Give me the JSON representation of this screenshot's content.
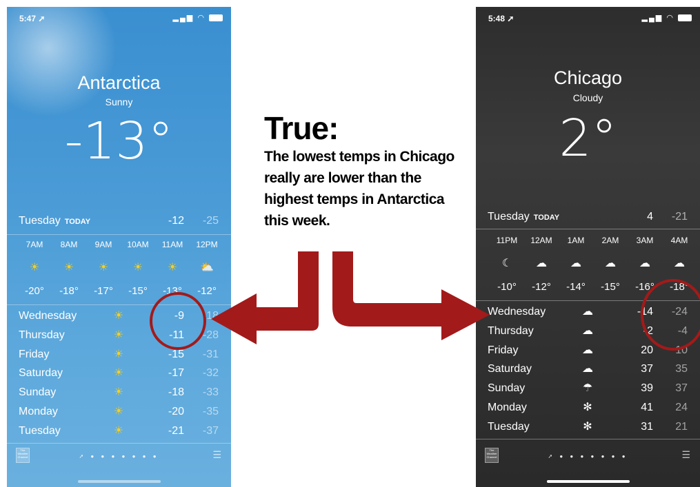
{
  "left_phone": {
    "status_time": "5:47",
    "city": "Antarctica",
    "condition": "Sunny",
    "temp": "-13°",
    "today": {
      "day": "Tuesday",
      "label": "TODAY",
      "hi": "-12",
      "lo": "-25"
    },
    "hourly": [
      {
        "t": "7AM",
        "icon": "sun-icon",
        "v": "-20°"
      },
      {
        "t": "8AM",
        "icon": "sun-icon",
        "v": "-18°"
      },
      {
        "t": "9AM",
        "icon": "sun-icon",
        "v": "-17°"
      },
      {
        "t": "10AM",
        "icon": "sun-icon",
        "v": "-15°"
      },
      {
        "t": "11AM",
        "icon": "sun-icon",
        "v": "-13°"
      },
      {
        "t": "12PM",
        "icon": "partly-sunny-icon",
        "v": "-12°"
      }
    ],
    "daily": [
      {
        "day": "Wednesday",
        "icon": "sun-icon",
        "hi": "-9",
        "lo": "-18"
      },
      {
        "day": "Thursday",
        "icon": "sun-icon",
        "hi": "-11",
        "lo": "-28"
      },
      {
        "day": "Friday",
        "icon": "sun-icon",
        "hi": "-15",
        "lo": "-31"
      },
      {
        "day": "Saturday",
        "icon": "sun-icon",
        "hi": "-17",
        "lo": "-32"
      },
      {
        "day": "Sunday",
        "icon": "sun-icon",
        "hi": "-18",
        "lo": "-33"
      },
      {
        "day": "Monday",
        "icon": "sun-icon",
        "hi": "-20",
        "lo": "-35"
      },
      {
        "day": "Tuesday",
        "icon": "sun-icon",
        "hi": "-21",
        "lo": "-37"
      }
    ],
    "footer_logo": "The Weather Channel"
  },
  "right_phone": {
    "status_time": "5:48",
    "city": "Chicago",
    "condition": "Cloudy",
    "temp": "2°",
    "today": {
      "day": "Tuesday",
      "label": "TODAY",
      "hi": "4",
      "lo": "-21"
    },
    "hourly": [
      {
        "t": "11PM",
        "icon": "moon-icon",
        "v": "-10°"
      },
      {
        "t": "12AM",
        "icon": "cloudy-night-icon",
        "v": "-12°"
      },
      {
        "t": "1AM",
        "icon": "cloudy-night-icon",
        "v": "-14°"
      },
      {
        "t": "2AM",
        "icon": "cloudy-night-icon",
        "v": "-15°"
      },
      {
        "t": "3AM",
        "icon": "cloudy-night-icon",
        "v": "-16°"
      },
      {
        "t": "4AM",
        "icon": "cloudy-night-icon",
        "v": "-18°"
      }
    ],
    "daily": [
      {
        "day": "Wednesday",
        "icon": "cloud-icon",
        "hi": "-14",
        "lo": "-24"
      },
      {
        "day": "Thursday",
        "icon": "cloud-icon",
        "hi": "-2",
        "lo": "-4"
      },
      {
        "day": "Friday",
        "icon": "cloud-icon",
        "hi": "20",
        "lo": "10"
      },
      {
        "day": "Saturday",
        "icon": "cloud-icon",
        "hi": "37",
        "lo": "35"
      },
      {
        "day": "Sunday",
        "icon": "rain-icon",
        "hi": "39",
        "lo": "37"
      },
      {
        "day": "Monday",
        "icon": "snow-icon",
        "hi": "41",
        "lo": "24"
      },
      {
        "day": "Tuesday",
        "icon": "snow-icon",
        "hi": "31",
        "lo": "21"
      }
    ],
    "footer_logo": "The Weather Channel"
  },
  "caption": {
    "title": "True:",
    "body": "The lowest temps in Chicago really are lower than the highest temps in Antarctica this week."
  },
  "colors": {
    "arrow": "#a31a1a",
    "sky": "#4a9bd6",
    "night": "#333333"
  }
}
